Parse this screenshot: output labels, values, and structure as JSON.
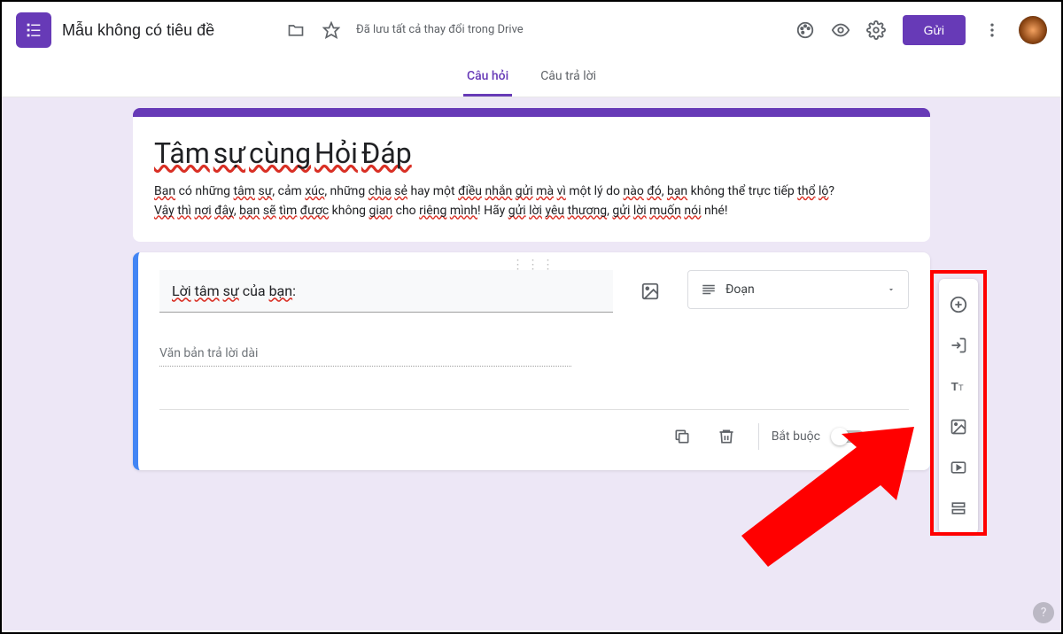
{
  "header": {
    "title": "Mẫu không có tiêu đề",
    "save_status": "Đã lưu tất cả thay đổi trong Drive",
    "send_label": "Gửi"
  },
  "tabs": {
    "questions": "Câu hỏi",
    "responses": "Câu trả lời"
  },
  "form": {
    "title_parts": {
      "t1": "Tâm",
      "t2": "sự",
      "t3": "cùng",
      "t4": "Hỏi",
      "t5": "Đáp"
    },
    "desc_parts": {
      "p1": "Bạn",
      "p2": "có những",
      "p3": "tâm",
      "p4": "sự",
      "p5": ", cảm",
      "p6": "xúc",
      "p7": ", những",
      "p8": "chia",
      "p9": "sẻ",
      "p10": "hay một",
      "p11": "điều",
      "p12": "nhắn",
      "p13": "gửi",
      "p14": "mà",
      "p15": "vì",
      "p16": "một lý do",
      "p17": "nào",
      "p18": "đó",
      "p19": ",",
      "p20": "bạn",
      "p21": "không thể trực tiếp",
      "p22": "thổ",
      "p23": "lộ",
      "p24": "?",
      "line2a": "Vậy",
      "line2b": "thì",
      "line2c": "nơi",
      "line2d": "đây",
      "line2e": ",",
      "line2f": "bạn",
      "line2g": "sẽ",
      "line2h": "tìm",
      "line2i": "được",
      "line2j": "không",
      "line2k": "gian",
      "line2l": "cho",
      "line2m": "riêng",
      "line2n": "mình",
      "line2o": "! Hãy",
      "line2p": "gửi",
      "line2q": "lời",
      "line2r": "yêu",
      "line2s": "thương",
      "line2t": ",",
      "line2u": "gửi",
      "line2v": "lời",
      "line2w": "muốn",
      "line2x": "nói",
      "line2y": "nhé!"
    }
  },
  "question": {
    "text_parts": {
      "w1": "Lời",
      "w2": "tâm",
      "w3": "sự",
      "w4": "của",
      "w5": "bạn",
      "colon": ":"
    },
    "type_label": "Đoạn",
    "answer_placeholder": "Văn bản trả lời dài",
    "required_label": "Bắt buộc"
  },
  "side_toolbar": {
    "add": "add-question",
    "import": "import-questions",
    "title_desc": "add-title-description",
    "image": "add-image",
    "video": "add-video",
    "section": "add-section"
  }
}
